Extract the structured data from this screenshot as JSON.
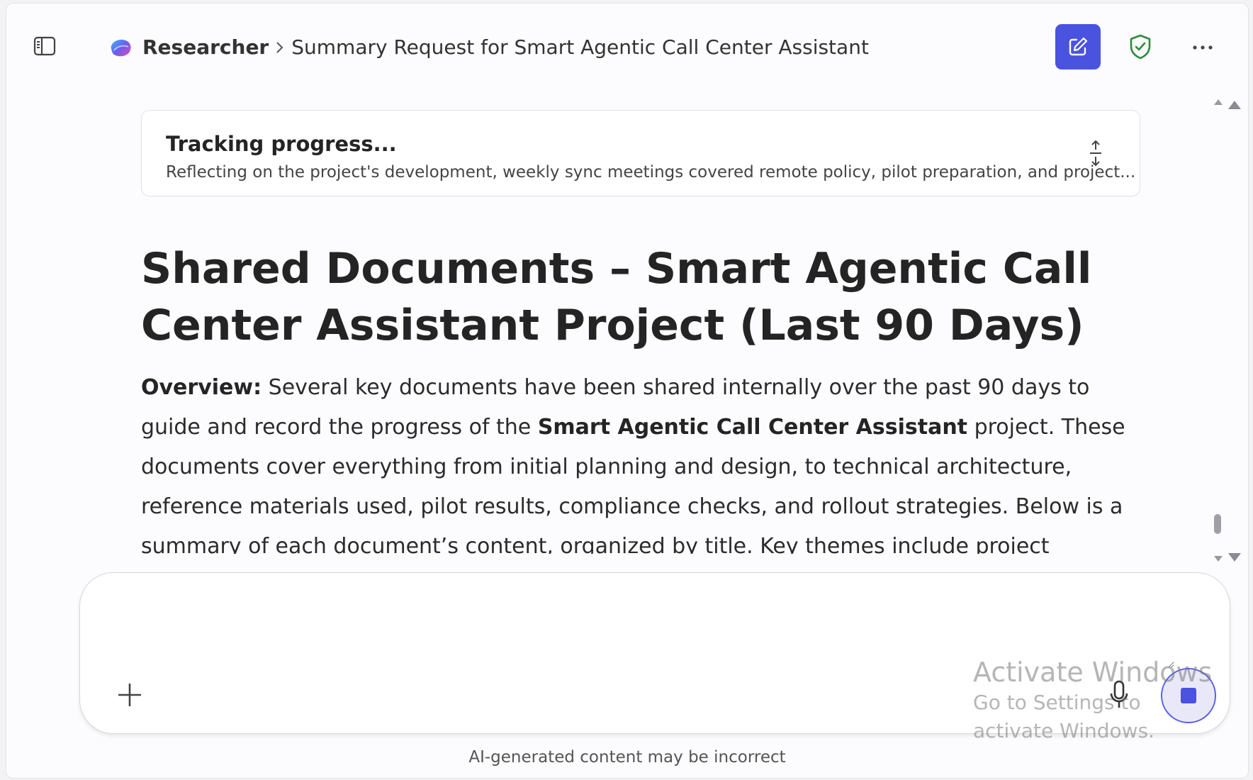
{
  "header": {
    "breadcrumb_root": "Researcher",
    "breadcrumb_current": "Summary Request for Smart Agentic Call Center Assistant"
  },
  "progress": {
    "title": "Tracking progress...",
    "subtitle": "Reflecting on the project's development, weekly sync meetings covered remote policy, pilot preparation, and project..."
  },
  "document": {
    "title": "Shared Documents – Smart Agentic Call Center Assistant Project (Last 90 Days)",
    "overview_label": "Overview:",
    "overview_part1": " Several key documents have been shared internally over the past 90 days to guide and record the progress of the ",
    "overview_bold": "Smart Agentic Call Center Assistant",
    "overview_part2": " project. These documents cover everything from initial planning and design, to technical architecture, reference materials used, pilot results, compliance checks, and rollout strategies. Below is a summary of each document’s content, organized by title. Key themes include project objectives and timelines, architectural and technical"
  },
  "composer": {
    "placeholder": ""
  },
  "watermark": {
    "title": "Activate Windows",
    "subtitle": "Go to Settings to activate Windows."
  },
  "footer": {
    "disclaimer": "AI-generated content may be incorrect"
  },
  "colors": {
    "accent": "#4a52e0",
    "shield_green": "#2e8b3a",
    "background": "#fcfbfd"
  },
  "icons": {
    "sidebar_toggle": "sidebar-icon",
    "logo": "copilot-logo-icon",
    "new_chat": "compose-icon",
    "shield": "shield-check-icon",
    "more": "more-horizontal-icon",
    "expand": "expand-collapse-icon",
    "add": "plus-icon",
    "mic": "microphone-icon",
    "stop": "stop-icon"
  }
}
